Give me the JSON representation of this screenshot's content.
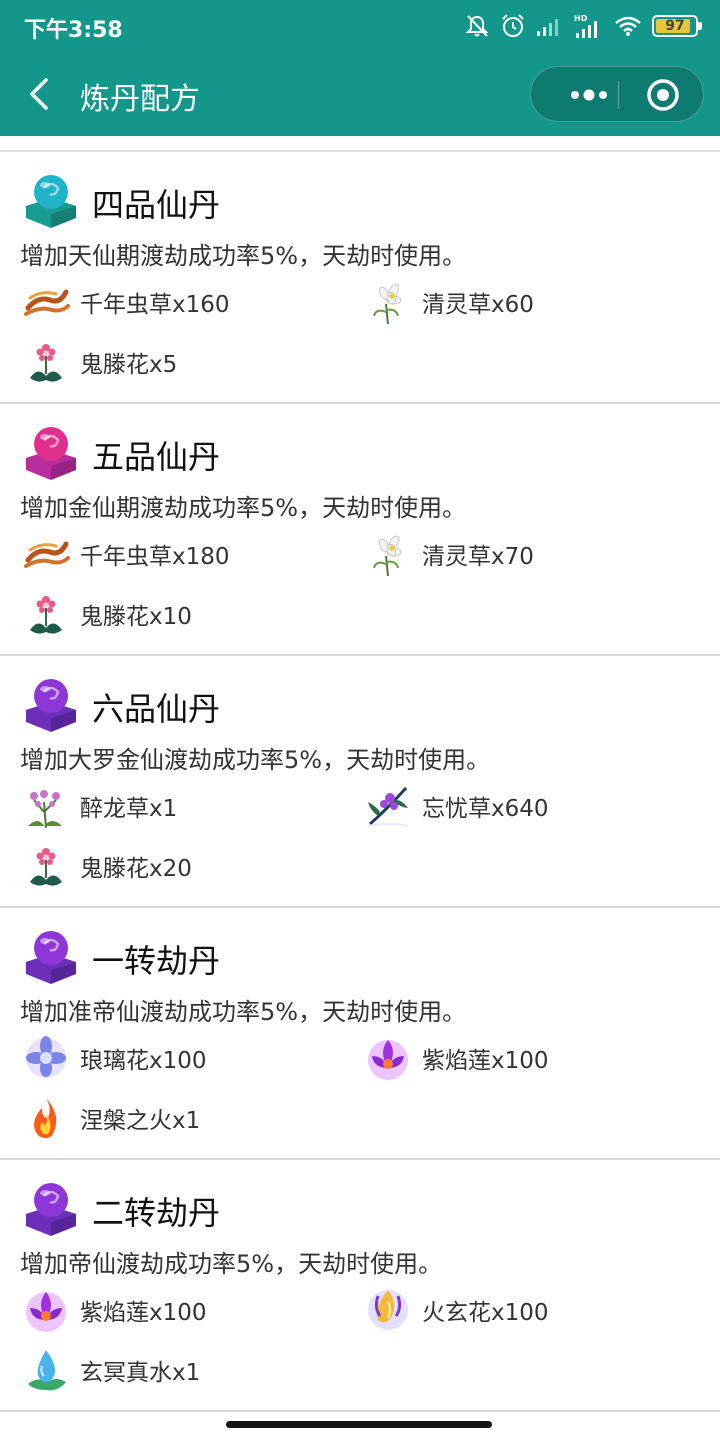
{
  "status_bar": {
    "time": "下午3:58",
    "battery": "97"
  },
  "nav": {
    "title": "炼丹配方"
  },
  "recipes": [
    {
      "name": "四品仙丹",
      "color": "#1fb3c9",
      "base": "#1a9b8f",
      "description": "增加天仙期渡劫成功率5%，天劫时使用。",
      "ingredients": [
        {
          "label": "千年虫草x160",
          "icon": "cordyceps-icon"
        },
        {
          "label": "清灵草x60",
          "icon": "white-herb-icon"
        },
        {
          "label": "鬼滕花x5",
          "icon": "pink-flower-icon"
        }
      ]
    },
    {
      "name": "五品仙丹",
      "color": "#e0308e",
      "base": "#b82d9d",
      "description": "增加金仙期渡劫成功率5%，天劫时使用。",
      "ingredients": [
        {
          "label": "千年虫草x180",
          "icon": "cordyceps-icon"
        },
        {
          "label": "清灵草x70",
          "icon": "white-herb-icon"
        },
        {
          "label": "鬼滕花x10",
          "icon": "pink-flower-icon"
        }
      ]
    },
    {
      "name": "六品仙丹",
      "color": "#8e36d6",
      "base": "#6b2fb8",
      "description": "增加大罗金仙渡劫成功率5%，天劫时使用。",
      "ingredients": [
        {
          "label": "醉龙草x1",
          "icon": "lilac-herb-icon"
        },
        {
          "label": "忘忧草x640",
          "icon": "violet-branch-icon"
        },
        {
          "label": "鬼滕花x20",
          "icon": "pink-flower-icon"
        }
      ]
    },
    {
      "name": "一转劫丹",
      "color": "#8e36d6",
      "base": "#6b2fb8",
      "description": "增加准帝仙渡劫成功率5%，天劫时使用。",
      "ingredients": [
        {
          "label": "琅璃花x100",
          "icon": "glass-flower-icon"
        },
        {
          "label": "紫焰莲x100",
          "icon": "purple-lotus-icon"
        },
        {
          "label": "涅槃之火x1",
          "icon": "fire-icon"
        }
      ]
    },
    {
      "name": "二转劫丹",
      "color": "#8e36d6",
      "base": "#6b2fb8",
      "description": "增加帝仙渡劫成功率5%，天劫时使用。",
      "ingredients": [
        {
          "label": "紫焰莲x100",
          "icon": "purple-lotus-icon"
        },
        {
          "label": "火玄花x100",
          "icon": "golden-flower-icon"
        },
        {
          "label": "玄冥真水x1",
          "icon": "water-drop-icon"
        }
      ]
    }
  ]
}
